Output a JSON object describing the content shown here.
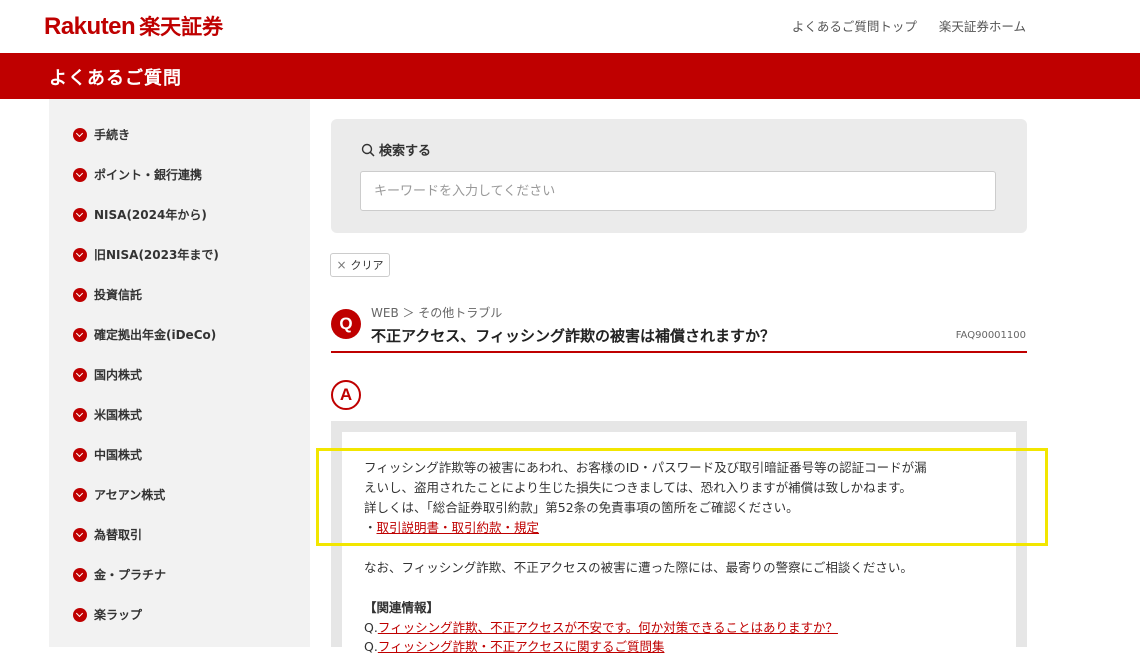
{
  "header": {
    "logo_en": "Rakuten",
    "logo_jp": "楽天証券",
    "links": [
      "よくあるご質問トップ",
      "楽天証券ホーム"
    ],
    "section_title": "よくあるご質問"
  },
  "sidebar": {
    "items": [
      {
        "label": "手続き"
      },
      {
        "label": "ポイント・銀行連携"
      },
      {
        "label": "NISA(2024年から)"
      },
      {
        "label": "旧NISA(2023年まで)"
      },
      {
        "label": "投資信託"
      },
      {
        "label": "確定拠出年金(iDeCo)"
      },
      {
        "label": "国内株式"
      },
      {
        "label": "米国株式"
      },
      {
        "label": "中国株式"
      },
      {
        "label": "アセアン株式"
      },
      {
        "label": "為替取引"
      },
      {
        "label": "金・プラチナ"
      },
      {
        "label": "楽ラップ"
      }
    ]
  },
  "search": {
    "label": "検索する",
    "placeholder": "キーワードを入力してください",
    "value": ""
  },
  "clear_label": "クリア",
  "question": {
    "badge": "Q",
    "breadcrumb": "WEB ＞ その他トラブル",
    "title": "不正アクセス、フィッシング詐欺の被害は補償されますか？",
    "faq_no": "FAQ90001100"
  },
  "answer": {
    "badge": "A",
    "line1": "フィッシング詐欺等の被害にあわれ、お客様のID・パスワード及び取引暗証番号等の認証コードが漏",
    "line2": "えいし、盗用されたことにより生じた損失につきましては、恐れ入りますが補償は致しかねます。",
    "line3": "詳しくは、「総合証券取引約款」第52条の免責事項の箇所をご確認ください。",
    "bullet": "・",
    "link1": "取引説明書・取引約款・規定",
    "line4": "なお、フィッシング詐欺、不正アクセスの被害に遭った際には、最寄りの警察にご相談ください。",
    "related_heading": "【関連情報】",
    "related": [
      {
        "prefix": "Q.",
        "text": "フィッシング詐欺、不正アクセスが不安です。何か対策できることはありますか？"
      },
      {
        "prefix": "Q.",
        "text": "フィッシング詐欺・不正アクセスに関するご質問集"
      }
    ]
  },
  "colors": {
    "brand_red": "#bf0000",
    "highlight_yellow": "#f2e600",
    "sidebar_bg": "#f2f2f2"
  }
}
